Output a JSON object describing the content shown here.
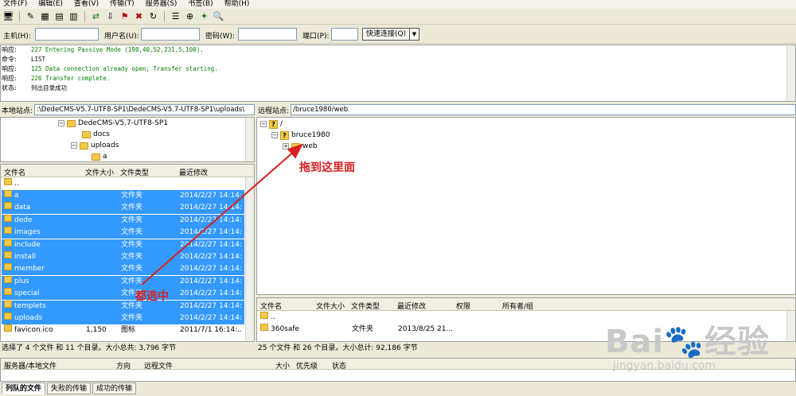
{
  "menu": [
    "文件(F)",
    "编辑(E)",
    "查看(V)",
    "传输(T)",
    "服务器(S)",
    "书签(B)",
    "帮助(H)"
  ],
  "quickconnect": {
    "host_label": "主机(H):",
    "user_label": "用户名(U):",
    "pass_label": "密码(W):",
    "port_label": "端口(P):",
    "button_label": "快速连接(Q)"
  },
  "log": [
    {
      "type": "响应:",
      "msg": "227 Entering Passive Mode (198,40,52,231,5,100).",
      "color": "#008000"
    },
    {
      "type": "命令:",
      "msg": "LIST",
      "color": "#000000"
    },
    {
      "type": "响应:",
      "msg": "125 Data connection already open; Transfer starting.",
      "color": "#008000"
    },
    {
      "type": "响应:",
      "msg": "226 Transfer complete.",
      "color": "#008000"
    },
    {
      "type": "状态:",
      "msg": "列出目录成功",
      "color": "#000000"
    }
  ],
  "local": {
    "path_label": "本地站点:",
    "path": ":\\DedeCMS-V5.7-UTF8-SP1\\DedeCMS-V5.7-UTF8-SP1\\uploads\\",
    "tree": [
      "DedeCMS-V5.7-UTF8-SP1",
      "docs",
      "uploads",
      "a"
    ],
    "columns": [
      "文件名",
      "文件大小",
      "文件类型",
      "最近修改"
    ],
    "parent": "..",
    "files": [
      {
        "name": "a",
        "size": "",
        "type": "文件夹",
        "modified": "2014/2/27 14:14:..."
      },
      {
        "name": "data",
        "size": "",
        "type": "文件夹",
        "modified": "2014/2/27 14:14:..."
      },
      {
        "name": "dede",
        "size": "",
        "type": "文件夹",
        "modified": "2014/2/27 14:14:..."
      },
      {
        "name": "images",
        "size": "",
        "type": "文件夹",
        "modified": "2014/2/27 14:14:..."
      },
      {
        "name": "include",
        "size": "",
        "type": "文件夹",
        "modified": "2014/2/27 14:14:..."
      },
      {
        "name": "install",
        "size": "",
        "type": "文件夹",
        "modified": "2014/2/27 14:14:..."
      },
      {
        "name": "member",
        "size": "",
        "type": "文件夹",
        "modified": "2014/2/27 14:14:..."
      },
      {
        "name": "plus",
        "size": "",
        "type": "文件夹",
        "modified": "2014/2/27 14:14:..."
      },
      {
        "name": "special",
        "size": "",
        "type": "文件夹",
        "modified": "2014/2/27 14:14:..."
      },
      {
        "name": "templets",
        "size": "",
        "type": "文件夹",
        "modified": "2014/2/27 14:14:..."
      },
      {
        "name": "uploads",
        "size": "",
        "type": "文件夹",
        "modified": "2014/2/27 14:14:..."
      },
      {
        "name": "favicon.ico",
        "size": "1,150",
        "type": "图标",
        "modified": "2011/7/1 16:14:..."
      }
    ],
    "status": "选择了 4 个文件 和 11 个目录。大小总共: 3,796 字节"
  },
  "remote": {
    "path_label": "远程站点:",
    "path": "/bruce1980/web",
    "tree": [
      "/",
      "bruce1980",
      "web"
    ],
    "columns": [
      "文件名",
      "文件大小",
      "文件类型",
      "最近修改",
      "权限",
      "所有者/组"
    ],
    "parent": "..",
    "files": [
      {
        "name": "360safe",
        "size": "",
        "type": "文件夹",
        "modified": "2013/8/25 21..."
      }
    ],
    "status": "25 个文件 和 26 个目录。大小总计: 92,186 字节"
  },
  "queue": {
    "columns": [
      "服务器/本地文件",
      "方向",
      "远程文件",
      "大小",
      "优先级",
      "状态"
    ]
  },
  "tabs": [
    "列队的文件",
    "失败的传输",
    "成功的传输"
  ],
  "annotations": {
    "drag_here": "拖到这里面",
    "select_all": "都选中"
  },
  "watermark": {
    "brand": "Bai",
    "brand_cn": "经验",
    "url": "jingyan.baidu.com"
  },
  "colors": {
    "selection": "#3399ff",
    "annotation": "#d62020",
    "log_response": "#008000"
  }
}
